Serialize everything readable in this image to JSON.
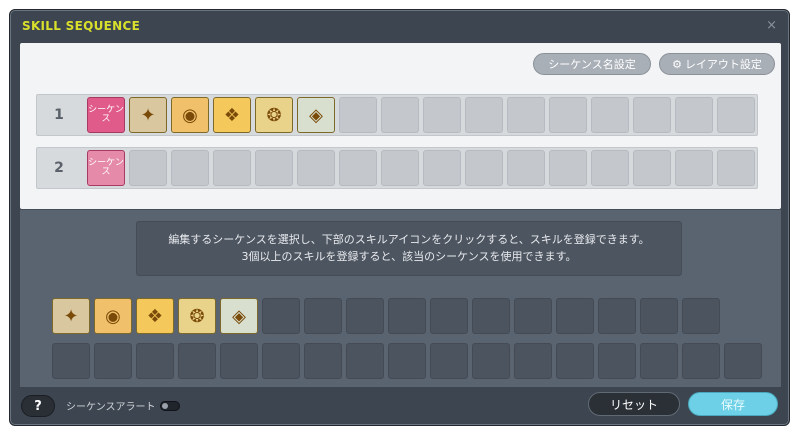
{
  "window": {
    "title": "SKILL SEQUENCE",
    "close_icon": "×"
  },
  "toolbar": {
    "rename_label": "シーケンス名設定",
    "layout_label": "レイアウト設定",
    "gear_icon": "⚙"
  },
  "sequences": [
    {
      "number": "1",
      "toggle_label": "シーケンス",
      "skills": [
        "compass-emblem",
        "gold-medallion",
        "gold-wing-crest",
        "gold-aura-ring",
        "diamond-compass"
      ]
    },
    {
      "number": "2",
      "toggle_label": "シーケンス",
      "skills": []
    }
  ],
  "info": {
    "line1": "編集するシーケンスを選択し、下部のスキルアイコンをクリックすると、スキルを登録できます。",
    "line2": "3個以上のスキルを登録すると、該当のシーケンスを使用できます。"
  },
  "palette": {
    "skills": [
      "compass-emblem",
      "gold-medallion",
      "gold-wing-crest",
      "gold-aura-ring",
      "diamond-compass"
    ]
  },
  "footer": {
    "help_label": "?",
    "alert_label": "シーケンスアラート",
    "reset_label": "リセット",
    "save_label": "保存"
  },
  "colors": {
    "title": "#d9e02b",
    "pink": "#e05a8a",
    "save": "#6dd0e6"
  }
}
